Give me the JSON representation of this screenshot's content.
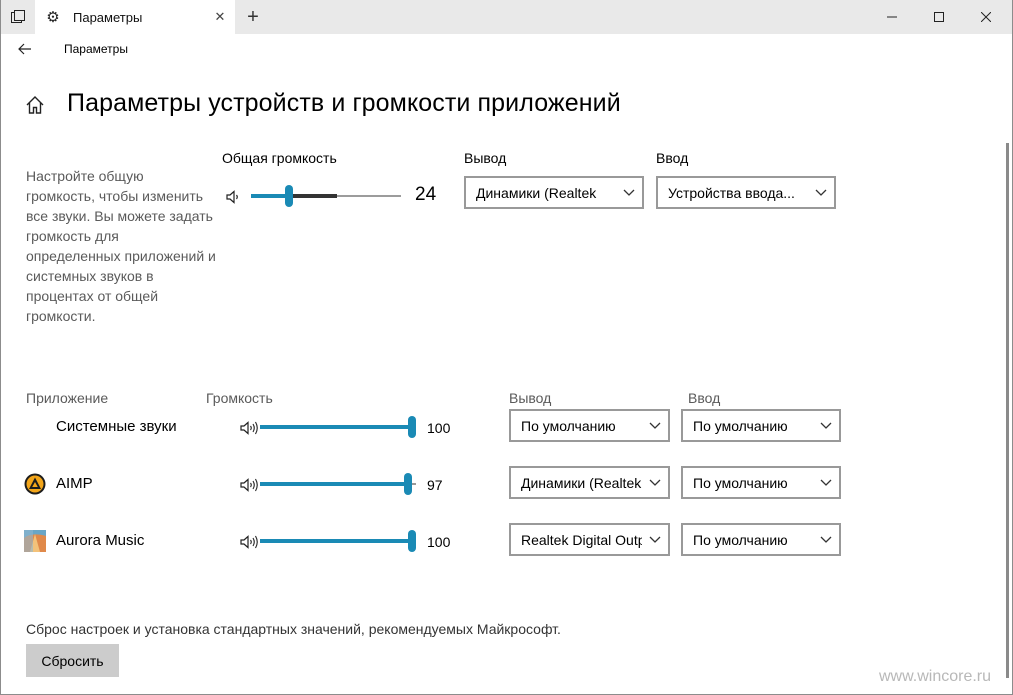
{
  "window": {
    "tab_title": "Параметры",
    "nav_title": "Параметры"
  },
  "page": {
    "title": "Параметры устройств и громкости приложений",
    "description": "Настройте общую громкость, чтобы изменить все звуки. Вы можете задать громкость для определенных приложений и системных звуков в процентах от общей громкости."
  },
  "master": {
    "label": "Общая громкость",
    "value": "24",
    "level": 0.24,
    "output_label": "Вывод",
    "output_value": "Динамики (Realtek",
    "input_label": "Ввод",
    "input_value": "Устройства ввода..."
  },
  "columns": {
    "app": "Приложение",
    "volume": "Громкость",
    "output": "Вывод",
    "input": "Ввод"
  },
  "apps": [
    {
      "name": "Системные звуки",
      "volume": "100",
      "level": 1.0,
      "output": "По умолчанию",
      "input": "По умолчанию",
      "icon": "none"
    },
    {
      "name": "AIMP",
      "volume": "97",
      "level": 0.97,
      "output": "Динамики (Realtek",
      "input": "По умолчанию",
      "icon": "aimp-icon"
    },
    {
      "name": "Aurora Music",
      "volume": "100",
      "level": 1.0,
      "output": "Realtek Digital Output",
      "input": "По умолчанию",
      "icon": "aurora-music-icon"
    }
  ],
  "reset": {
    "text": "Сброс настроек и установка стандартных значений, рекомендуемых Майкрософт.",
    "button": "Сбросить"
  },
  "watermark": "www.wincore.ru",
  "colors": {
    "accent": "#1a8ab5",
    "titlebar": "#e9e9e9",
    "button": "#cccccc"
  }
}
